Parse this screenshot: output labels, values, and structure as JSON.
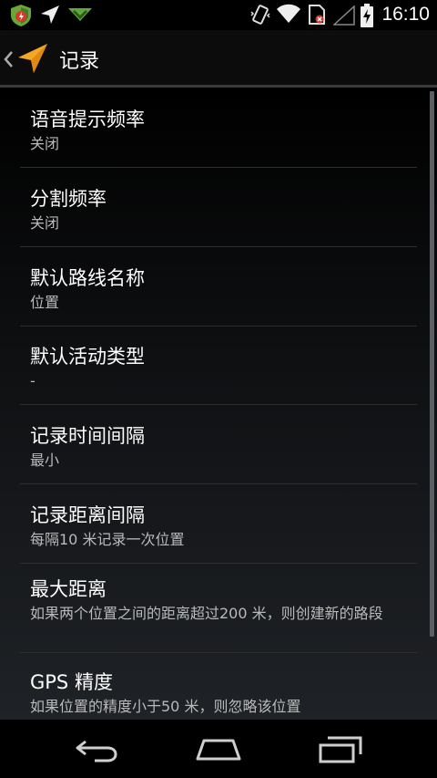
{
  "status_bar": {
    "time": "16:10",
    "left_icons": [
      "shield-app-icon",
      "navigation-arrow-icon",
      "download-chevron-icon"
    ],
    "right_icons": [
      "vibrate-icon",
      "wifi-icon",
      "sim-card-icon",
      "cell-signal-icon",
      "battery-charging-icon"
    ]
  },
  "action_bar": {
    "title": "记录",
    "icons": [
      "chevron-left-icon",
      "navigation-arrow-icon"
    ]
  },
  "preferences": [
    {
      "title": "语音提示频率",
      "summary": "关闭"
    },
    {
      "title": "分割频率",
      "summary": "关闭"
    },
    {
      "title": "默认路线名称",
      "summary": "位置"
    },
    {
      "title": "默认活动类型",
      "summary": "-"
    },
    {
      "title": "记录时间间隔",
      "summary": "最小"
    },
    {
      "title": "记录距离间隔",
      "summary": "每隔10 米记录一次位置"
    },
    {
      "title": "最大距离",
      "summary": "如果两个位置之间的距离超过200 米，则创建新的路段"
    },
    {
      "title": "GPS 精度",
      "summary": "如果位置的精度小于50 米，则忽略该位置"
    }
  ],
  "nav_bar": {
    "icons": [
      "back-icon",
      "home-icon",
      "recent-apps-icon"
    ]
  },
  "colors": {
    "accent_orange": "#f5a623",
    "summary_text": "#b9b9b9",
    "divider": "#2b2e32"
  }
}
